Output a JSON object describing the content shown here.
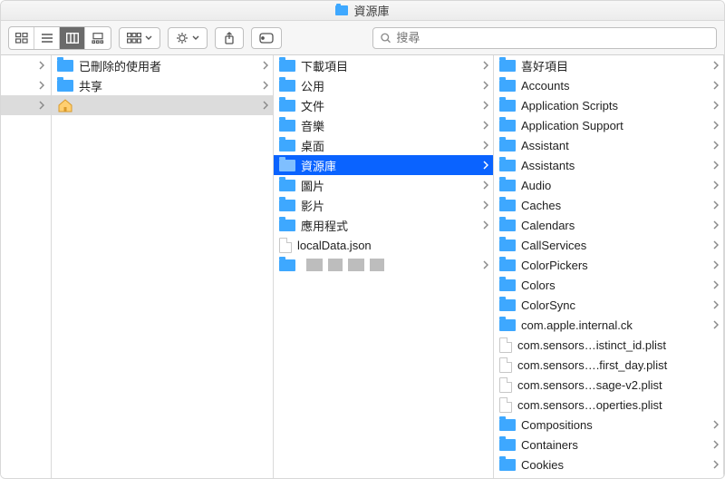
{
  "window": {
    "title": "資源庫"
  },
  "toolbar": {
    "view_mode_active": "column",
    "search_placeholder": "搜尋"
  },
  "col0_rows": 3,
  "col1": [
    {
      "icon": "folder",
      "label": "已刪除的使用者",
      "has_children": true,
      "state": "normal"
    },
    {
      "icon": "folder",
      "label": "共享",
      "has_children": true,
      "state": "normal"
    },
    {
      "icon": "home",
      "label": "",
      "has_children": true,
      "state": "path"
    }
  ],
  "col2": [
    {
      "icon": "folder",
      "label": "下載項目",
      "has_children": true,
      "state": "normal"
    },
    {
      "icon": "folder",
      "label": "公用",
      "has_children": true,
      "state": "normal"
    },
    {
      "icon": "folder",
      "label": "文件",
      "has_children": true,
      "state": "normal"
    },
    {
      "icon": "folder",
      "label": "音樂",
      "has_children": true,
      "state": "normal"
    },
    {
      "icon": "folder",
      "label": "桌面",
      "has_children": true,
      "state": "normal"
    },
    {
      "icon": "folder",
      "label": "資源庫",
      "has_children": true,
      "state": "selected"
    },
    {
      "icon": "folder",
      "label": "圖片",
      "has_children": true,
      "state": "normal"
    },
    {
      "icon": "folder",
      "label": "影片",
      "has_children": true,
      "state": "normal"
    },
    {
      "icon": "folder",
      "label": "應用程式",
      "has_children": true,
      "state": "normal"
    },
    {
      "icon": "file",
      "label": "localData.json",
      "has_children": false,
      "state": "normal"
    },
    {
      "icon": "folder",
      "label": "",
      "has_children": true,
      "state": "normal",
      "redacted": true
    }
  ],
  "col3": [
    {
      "icon": "folder",
      "label": "喜好項目",
      "has_children": true
    },
    {
      "icon": "folder",
      "label": "Accounts",
      "has_children": true
    },
    {
      "icon": "folder",
      "label": "Application Scripts",
      "has_children": true
    },
    {
      "icon": "folder",
      "label": "Application Support",
      "has_children": true
    },
    {
      "icon": "folder",
      "label": "Assistant",
      "has_children": true
    },
    {
      "icon": "folder",
      "label": "Assistants",
      "has_children": true
    },
    {
      "icon": "folder",
      "label": "Audio",
      "has_children": true
    },
    {
      "icon": "folder",
      "label": "Caches",
      "has_children": true
    },
    {
      "icon": "folder",
      "label": "Calendars",
      "has_children": true
    },
    {
      "icon": "folder",
      "label": "CallServices",
      "has_children": true
    },
    {
      "icon": "folder",
      "label": "ColorPickers",
      "has_children": true
    },
    {
      "icon": "folder",
      "label": "Colors",
      "has_children": true
    },
    {
      "icon": "folder",
      "label": "ColorSync",
      "has_children": true
    },
    {
      "icon": "folder",
      "label": "com.apple.internal.ck",
      "has_children": true
    },
    {
      "icon": "file",
      "label": "com.sensors…istinct_id.plist",
      "has_children": false
    },
    {
      "icon": "file",
      "label": "com.sensors….first_day.plist",
      "has_children": false
    },
    {
      "icon": "file",
      "label": "com.sensors…sage-v2.plist",
      "has_children": false
    },
    {
      "icon": "file",
      "label": "com.sensors…operties.plist",
      "has_children": false
    },
    {
      "icon": "folder",
      "label": "Compositions",
      "has_children": true
    },
    {
      "icon": "folder",
      "label": "Containers",
      "has_children": true
    },
    {
      "icon": "folder",
      "label": "Cookies",
      "has_children": true
    }
  ]
}
